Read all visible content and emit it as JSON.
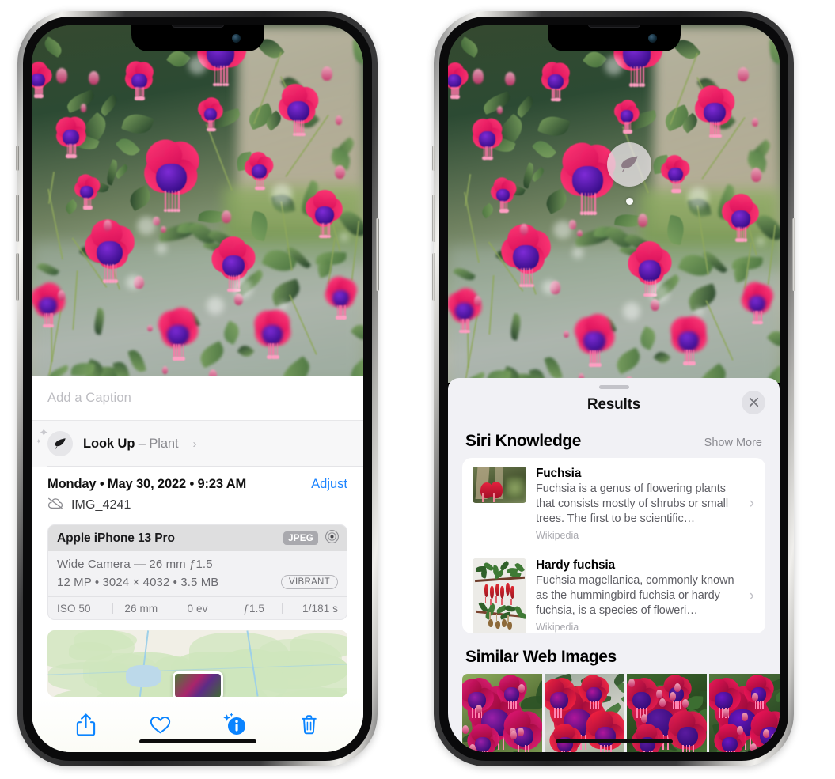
{
  "left_phone": {
    "caption": {
      "placeholder": "Add a Caption",
      "value": ""
    },
    "look_up": {
      "label": "Look Up",
      "dash": "–",
      "subject": "Plant",
      "chevron": "›",
      "icon": "leaf-icon"
    },
    "metadata": {
      "date_line": "Monday • May 30, 2022 • 9:23 AM",
      "adjust_label": "Adjust",
      "filename": "IMG_4241",
      "cloud_icon": "icloud-slash-icon"
    },
    "camera_card": {
      "device": "Apple iPhone 13 Pro",
      "format_tag": "JPEG",
      "raw_icon": "aperture-icon",
      "lens_line": "Wide Camera — 26 mm ƒ1.5",
      "size_line": "12 MP • 3024 × 4032 • 3.5 MB",
      "style_tag": "VIBRANT",
      "exif": [
        "ISO 50",
        "26 mm",
        "0 ev",
        "ƒ1.5",
        "1/181 s"
      ]
    },
    "toolbar": [
      {
        "name": "share-icon",
        "label": "Share"
      },
      {
        "name": "heart-icon",
        "label": "Favorite"
      },
      {
        "name": "info-sparkle-icon",
        "label": "Info"
      },
      {
        "name": "trash-icon",
        "label": "Delete"
      }
    ]
  },
  "right_phone": {
    "visual_look_up_badge": {
      "icon": "leaf-icon"
    },
    "sheet": {
      "title": "Results",
      "close_icon": "close-icon",
      "grabber": "drag-handle"
    },
    "siri_knowledge": {
      "title": "Siri Knowledge",
      "show_more": "Show More",
      "items": [
        {
          "name": "Fuchsia",
          "description": "Fuchsia is a genus of flowering plants that consists mostly of shrubs or small trees. The first to be scientific…",
          "source": "Wikipedia",
          "chevron": "›"
        },
        {
          "name": "Hardy fuchsia",
          "description": "Fuchsia magellanica, commonly known as the hummingbird fuchsia or hardy fuchsia, is a species of floweri…",
          "source": "Wikipedia",
          "chevron": "›"
        }
      ]
    },
    "similar_web_images": {
      "title": "Similar Web Images",
      "count": 4
    }
  },
  "colors": {
    "accent_blue": "#1c84ff",
    "sheet_gray": "#f1f1f5",
    "card_white": "#ffffff",
    "tag_gray": "#a9a9ae",
    "secondary_text": "#8a8a90"
  }
}
